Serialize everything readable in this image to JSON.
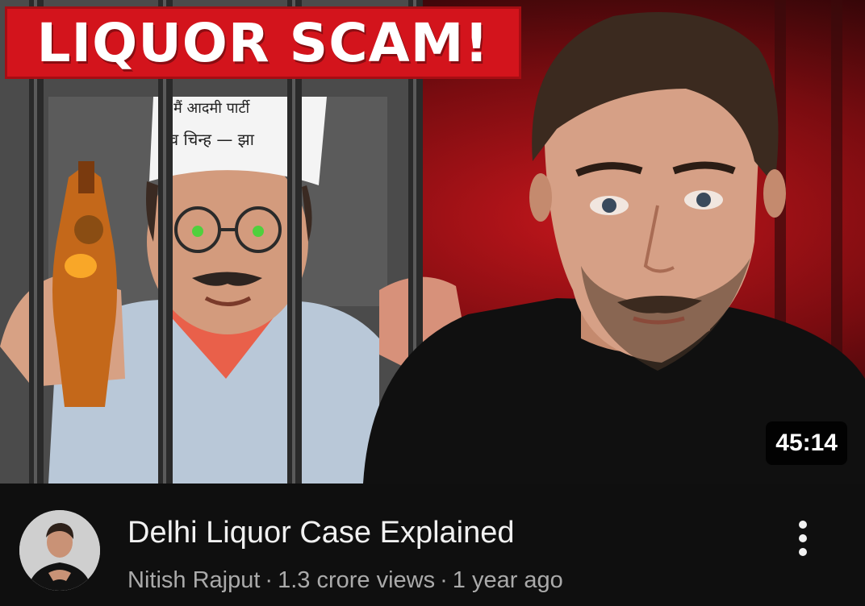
{
  "thumbnail": {
    "banner_text": "LIQUOR SCAM!",
    "cap_text_1": "मैं आदमी पार्टी",
    "cap_text_2": "व चिन्ह",
    "duration": "45:14"
  },
  "video": {
    "title": "Delhi Liquor Case Explained",
    "channel": "Nitish Rajput",
    "separator": "·",
    "views": "1.3 crore views",
    "age": "1 year ago"
  },
  "icons": {
    "more": "more-vertical-icon"
  },
  "colors": {
    "banner_red": "#d3141c",
    "background": "#0f0f0f",
    "title_text": "#f1f1f1",
    "meta_text": "#aaaaaa"
  }
}
